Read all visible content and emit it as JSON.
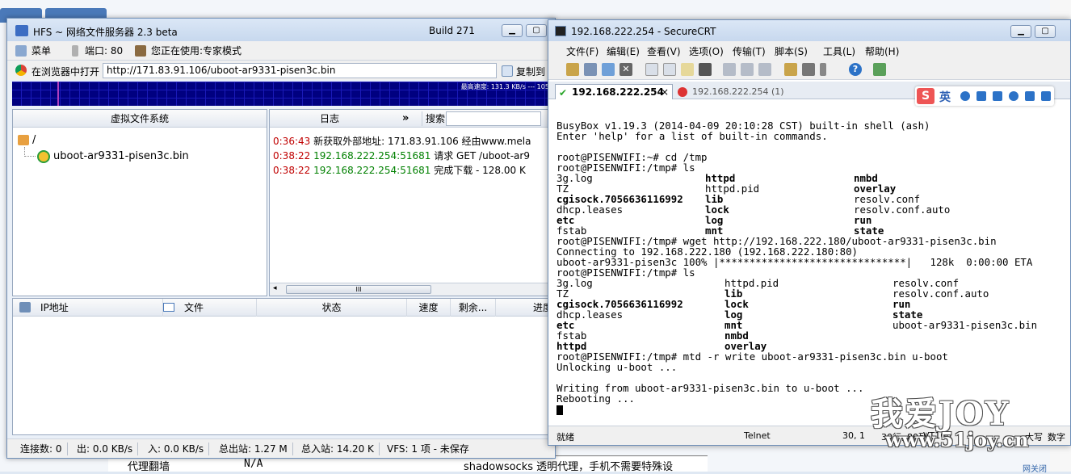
{
  "background": {
    "table_row": {
      "col1": "代理翻墙",
      "col2": "N/A",
      "col3": "shadowsocks 透明代理，手机不需要特殊设"
    },
    "bottom_link": "网关闭"
  },
  "hfs": {
    "title": "HFS ~ 网络文件服务器 2.3 beta",
    "build": "Build 271",
    "toolbar": {
      "menu": "菜单",
      "port": "端口: 80",
      "mode": "您正在使用:专家模式"
    },
    "open_in_browser": "在浏览器中打开",
    "url": "http://171.83.91.106/uboot-ar9331-pisen3c.bin",
    "copy": "复制到",
    "graph_speed": "最高速度: 131.3 KB/s --- 1051",
    "vfs": {
      "header": "虚拟文件系统",
      "root": "/",
      "file": "uboot-ar9331-pisen3c.bin"
    },
    "log": {
      "title": "日志",
      "chevron": "»",
      "search_label": "搜索",
      "lines": [
        {
          "time": "0:36:43",
          "ip": "",
          "text": "新获取外部地址: 171.83.91.106 经由www.mela"
        },
        {
          "time": "0:38:22",
          "ip": "192.168.222.254:51681",
          "text": "请求 GET /uboot-ar9"
        },
        {
          "time": "0:38:22",
          "ip": "192.168.222.254:51681",
          "text": "完成下载 - 128.00 K"
        }
      ],
      "scroll_grip": "III"
    },
    "conn_columns": {
      "ip": "IP地址",
      "file": "文件",
      "status": "状态",
      "speed": "速度",
      "remaining": "剩余...",
      "progress": "进度"
    },
    "status": {
      "connections": "连接数: 0",
      "out": "出: 0.0 KB/s",
      "in": "入: 0.0 KB/s",
      "total_out": "总出站: 1.27 M",
      "total_in": "总入站: 14.20 K",
      "vfs": "VFS: 1 项 - 未保存"
    }
  },
  "crt": {
    "title": "192.168.222.254 - SecureCRT",
    "menu": [
      "文件(F)",
      "编辑(E)",
      "查看(V)",
      "选项(O)",
      "传输(T)",
      "脚本(S)",
      "工具(L)",
      "帮助(H)"
    ],
    "tabs": {
      "active": "192.168.222.254",
      "inactive": "192.168.222.254 (1)",
      "close": "×"
    },
    "ime": {
      "logo": "S",
      "mode": "英"
    },
    "terminal": {
      "l01": "BusyBox v1.19.3 (2014-04-09 20:10:28 CST) built-in shell (ash)",
      "l02": "Enter 'help' for a list of built-in commands.",
      "l03": "root@PISENWIFI:~# cd /tmp",
      "l04": "root@PISENWIFI:/tmp# ls",
      "ls1": [
        [
          {
            "t": "3g.log",
            "b": false
          },
          {
            "t": "httpd",
            "b": true
          },
          {
            "t": "nmbd",
            "b": true
          }
        ],
        [
          {
            "t": "TZ",
            "b": false
          },
          {
            "t": "httpd.pid",
            "b": false
          },
          {
            "t": "overlay",
            "b": true
          }
        ],
        [
          {
            "t": "cgisock.7056636116992",
            "b": true
          },
          {
            "t": "lib",
            "b": true
          },
          {
            "t": "resolv.conf",
            "b": false
          }
        ],
        [
          {
            "t": "dhcp.leases",
            "b": false
          },
          {
            "t": "lock",
            "b": true
          },
          {
            "t": "resolv.conf.auto",
            "b": false
          }
        ],
        [
          {
            "t": "etc",
            "b": true
          },
          {
            "t": "log",
            "b": true
          },
          {
            "t": "run",
            "b": true
          }
        ],
        [
          {
            "t": "fstab",
            "b": false
          },
          {
            "t": "mnt",
            "b": true
          },
          {
            "t": "state",
            "b": true
          }
        ]
      ],
      "l11": "root@PISENWIFI:/tmp# wget http://192.168.222.180/uboot-ar9331-pisen3c.bin",
      "l12": "Connecting to 192.168.222.180 (192.168.222.180:80)",
      "l13": "uboot-ar9331-pisen3c 100% |*******************************|   128k  0:00:00 ETA",
      "l14": "root@PISENWIFI:/tmp# ls",
      "ls2": [
        [
          {
            "t": "3g.log",
            "b": false
          },
          {
            "t": "httpd.pid",
            "b": false
          },
          {
            "t": "resolv.conf",
            "b": false
          }
        ],
        [
          {
            "t": "TZ",
            "b": false
          },
          {
            "t": "lib",
            "b": true
          },
          {
            "t": "resolv.conf.auto",
            "b": false
          }
        ],
        [
          {
            "t": "cgisock.7056636116992",
            "b": true
          },
          {
            "t": "lock",
            "b": true
          },
          {
            "t": "run",
            "b": true
          }
        ],
        [
          {
            "t": "dhcp.leases",
            "b": false
          },
          {
            "t": "log",
            "b": true
          },
          {
            "t": "state",
            "b": true
          }
        ],
        [
          {
            "t": "etc",
            "b": true
          },
          {
            "t": "mnt",
            "b": true
          },
          {
            "t": "uboot-ar9331-pisen3c.bin",
            "b": false
          }
        ],
        [
          {
            "t": "fstab",
            "b": false
          },
          {
            "t": "nmbd",
            "b": true
          },
          {
            "t": "",
            "b": false
          }
        ],
        [
          {
            "t": "httpd",
            "b": true
          },
          {
            "t": "overlay",
            "b": true
          },
          {
            "t": "",
            "b": false
          }
        ]
      ],
      "l22": "root@PISENWIFI:/tmp# mtd -r write uboot-ar9331-pisen3c.bin u-boot",
      "l23": "Unlocking u-boot ...",
      "l24": "",
      "l25": "Writing from uboot-ar9331-pisen3c.bin to u-boot ...",
      "l26": "Rebooting ..."
    },
    "status": {
      "ready": "就绪",
      "protocol": "Telnet",
      "cursor": "30,  1",
      "size": "30行, 80列",
      "term": "VT100",
      "caps": "大写",
      "num": "数字"
    }
  },
  "watermark": {
    "text": "我爱JOY",
    "url": "www.51joy.cn"
  },
  "colors": {
    "graph_bg": "#000080",
    "log_time": "#c00000",
    "log_ip": "#008000"
  }
}
